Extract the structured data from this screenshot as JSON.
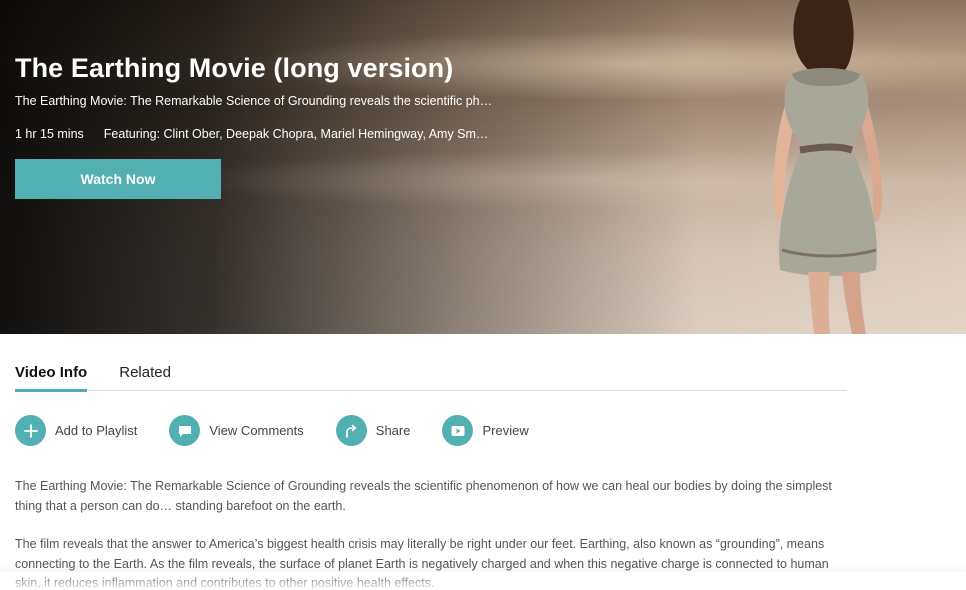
{
  "hero": {
    "title": "The Earthing Movie (long version)",
    "description": "The Earthing Movie: The Remarkable Science of Grounding reveals the scientific ph…",
    "duration": "1 hr 15 mins",
    "featuring": "Featuring: Clint Ober, Deepak Chopra, Mariel Hemingway, Amy Sm…",
    "watch_label": "Watch Now"
  },
  "tabs": [
    {
      "label": "Video Info",
      "active": true
    },
    {
      "label": "Related",
      "active": false
    }
  ],
  "actions": [
    {
      "label": "Add to Playlist",
      "icon": "plus-icon"
    },
    {
      "label": "View Comments",
      "icon": "comment-icon"
    },
    {
      "label": "Share",
      "icon": "share-arrow-icon"
    },
    {
      "label": "Preview",
      "icon": "play-preview-icon"
    }
  ],
  "description": {
    "p1": "The Earthing Movie: The Remarkable Science of Grounding reveals the scientific phenomenon of how we can heal our bodies by doing the simplest thing that a person can do… standing barefoot on the earth.",
    "p2": "The film reveals that the answer to America’s biggest health crisis may literally be right under our feet. Earthing, also known as “grounding”, means connecting to the Earth. As the film reveals, the surface of planet Earth is negatively charged and when this negative charge is connected to human skin, it reduces inflammation and contributes to other positive health effects."
  },
  "colors": {
    "accent": "#52b0b3"
  }
}
